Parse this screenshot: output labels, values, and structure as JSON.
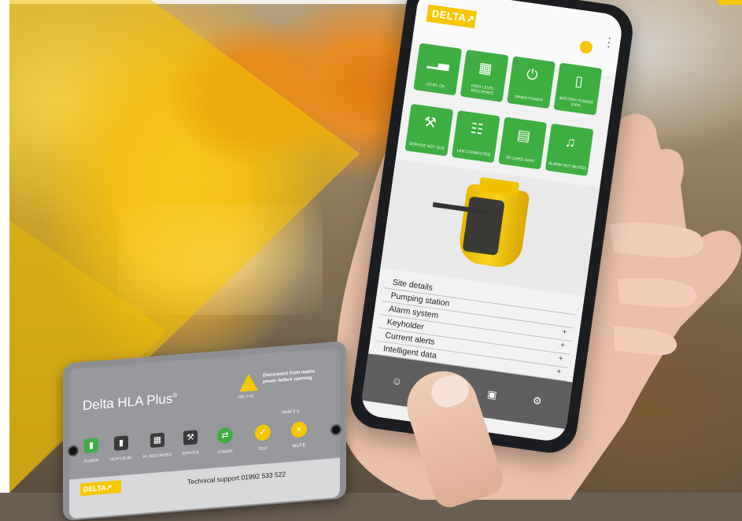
{
  "app": {
    "logo": "DELTA↗",
    "tiles": [
      {
        "icon_name": "graph-icon",
        "icon": "▁▃",
        "label": "LEVEL OK"
      },
      {
        "icon_name": "grid-icon",
        "icon": "▦",
        "label": "HIGH LEVEL RECORDED"
      },
      {
        "icon_name": "plug-icon",
        "icon": "⏻",
        "label": "MAINS POWER"
      },
      {
        "icon_name": "battery-icon",
        "icon": "▯",
        "label": "BATTERY POWER 100%"
      },
      {
        "icon_name": "wrench-icon",
        "icon": "⚒",
        "label": "SERVICE NOT DUE"
      },
      {
        "icon_name": "network-icon",
        "icon": "☷",
        "label": "LAN CONNECTED"
      },
      {
        "icon_name": "sd-card-icon",
        "icon": "▤",
        "label": "SD CARD OKAY"
      },
      {
        "icon_name": "speaker-icon",
        "icon": "♫",
        "label": "ALARM NOT MUTED"
      }
    ],
    "menu": [
      {
        "label": "Site details",
        "plus": ""
      },
      {
        "label": "Pumping station",
        "plus": ""
      },
      {
        "label": "Alarm system",
        "plus": "+"
      },
      {
        "label": "Keyholder",
        "plus": "+"
      },
      {
        "label": "Current alerts",
        "plus": "+"
      },
      {
        "label": "Intelligent data",
        "plus": "+"
      }
    ],
    "tabbar": [
      {
        "icon_name": "person-icon",
        "icon": "☺"
      },
      {
        "icon_name": "bell-icon",
        "icon": "♪"
      },
      {
        "icon_name": "calendar-icon",
        "icon": "▣"
      },
      {
        "icon_name": "gear-icon",
        "icon": "⚙"
      }
    ]
  },
  "device": {
    "title": "Delta HLA Plus",
    "title_mark": "®",
    "warning": "Disconnect from mains power before opening",
    "voltage": "230 V AC",
    "hold": "Hold 5 s",
    "buttons": [
      {
        "label": "POWER",
        "icon": "▮",
        "color": "#3fae43"
      },
      {
        "label": "HIGH LEVEL",
        "icon": "▮",
        "color": "#3a3a3a"
      },
      {
        "label": "HL RECORDED",
        "icon": "▦",
        "color": "#3a3a3a"
      },
      {
        "label": "SERVICE",
        "icon": "⚒",
        "color": "#3a3a3a"
      },
      {
        "label": "COMMS",
        "icon": "⇄",
        "color": "#3fae43"
      },
      {
        "label": "TEST",
        "icon": "✓",
        "color": "#f6c600"
      },
      {
        "label": "MUTE",
        "icon": "×",
        "color": "#f6c600"
      }
    ],
    "logo": "DELTA↗",
    "support": "Technical support 01992 533 522"
  },
  "colors": {
    "accent": "#f6c600",
    "tile_green": "#3fae43",
    "tabbar": "#5f5f5f"
  }
}
